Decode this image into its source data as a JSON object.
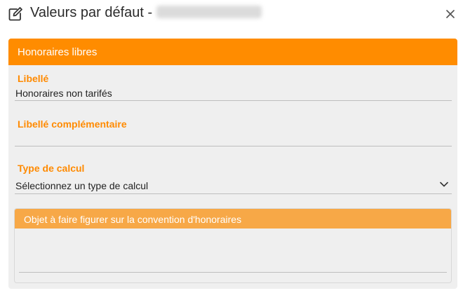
{
  "dialog": {
    "title": "Valeurs par défaut -",
    "close_icon": "close-icon",
    "edit_icon": "edit-icon"
  },
  "panel": {
    "header": "Honoraires libres",
    "fields": {
      "libelle": {
        "label": "Libellé",
        "value": "Honoraires non tarifés"
      },
      "libelle_complementaire": {
        "label": "Libellé complémentaire",
        "value": ""
      },
      "type_calcul": {
        "label": "Type de calcul",
        "value": "Sélectionnez un type de calcul"
      }
    },
    "subpanel": {
      "header": "Objet à faire figurer sur la convention d'honoraires",
      "value": ""
    }
  },
  "colors": {
    "accent": "#ff8c00",
    "accent_light": "#f7a847",
    "label": "#ff8a00"
  }
}
